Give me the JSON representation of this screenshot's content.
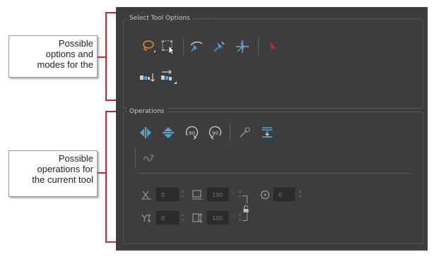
{
  "panel": {
    "background": "#3d3d3d",
    "accent_blue": "#4aa3df",
    "accent_orange": "#e08a2c"
  },
  "select_options": {
    "title": "Select Tool Options",
    "tools": [
      {
        "icon": "lasso-icon"
      },
      {
        "icon": "marquee-select-icon"
      },
      {
        "icon": "select-by-color-icon"
      },
      {
        "icon": "select-drawing-icon"
      },
      {
        "icon": "select-stroke-icon"
      },
      {
        "icon": "select-arrow-icon"
      },
      {
        "icon": "apply-to-line-icon"
      },
      {
        "icon": "apply-to-all-icon"
      }
    ]
  },
  "operations": {
    "title": "Operations",
    "tools": [
      {
        "icon": "flip-horizontal-icon"
      },
      {
        "icon": "flip-vertical-icon"
      },
      {
        "icon": "rotate-90-cw-icon",
        "text": "90"
      },
      {
        "icon": "rotate-90-ccw-icon",
        "text": "90"
      },
      {
        "icon": "create-color-art-icon"
      },
      {
        "icon": "flatten-icon"
      },
      {
        "icon": "smooth-icon"
      }
    ],
    "fields": {
      "x_value": "0",
      "y_value": "0",
      "width_value": "100",
      "height_value": "100",
      "angle_value": "0"
    }
  },
  "callouts": {
    "top": "Possible\noptions and\nmodes for the",
    "bottom": "Possible\noperations for\nthe current tool"
  },
  "colors": {
    "callout_bracket": "#d1232a"
  }
}
